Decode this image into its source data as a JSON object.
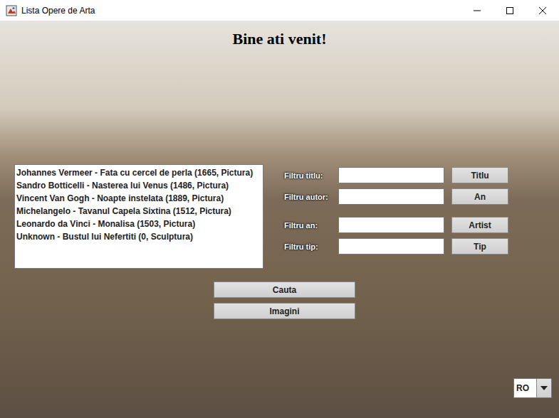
{
  "window": {
    "title": "Lista Opere de Arta"
  },
  "heading": "Bine ati venit!",
  "artworks": [
    "Johannes Vermeer - Fata cu cercel de perla (1665, Pictura)",
    "Sandro Botticelli - Nasterea lui Venus (1486, Pictura)",
    "Vincent Van Gogh - Noapte instelata (1889, Pictura)",
    "Michelangelo - Tavanul Capela Sixtina (1512, Pictura)",
    "Leonardo da Vinci - Monalisa (1503, Pictura)",
    "Unknown - Bustul lui Nefertiti (0, Sculptura)"
  ],
  "filters": [
    {
      "label": "Filtru titlu:",
      "value": "",
      "button": "Titlu"
    },
    {
      "label": "Filtru autor:",
      "value": "",
      "button": "An"
    },
    {
      "label": "Filtru an:",
      "value": "",
      "button": "Artist"
    },
    {
      "label": "Filtru tip:",
      "value": "",
      "button": "Tip"
    }
  ],
  "actions": [
    "Cauta",
    "Imagini"
  ],
  "language": {
    "value": "RO"
  }
}
